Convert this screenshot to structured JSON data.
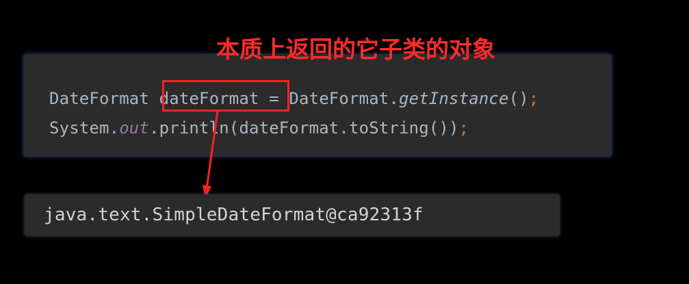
{
  "annotation": {
    "text": "本质上返回的它子类的对象",
    "color": "#ff2b2b"
  },
  "code": {
    "line1": {
      "class_name": "DateFormat",
      "variable": "dateFormat",
      "assign": " = DateFormat.",
      "method": "getInstance",
      "call": "()",
      "semicolon": ";"
    },
    "line2": {
      "system": "System.",
      "field": "out",
      "println": ".println(dateFormat.toString())",
      "semicolon": ";"
    }
  },
  "output": {
    "text": "java.text.SimpleDateFormat@ca92313f"
  },
  "colors": {
    "background": "#000000",
    "panel": "#2b2b2b",
    "code_text": "#a9b7c6",
    "keyword_orange": "#cc7832",
    "field_purple": "#9876aa",
    "highlight_red": "#ff2121"
  }
}
